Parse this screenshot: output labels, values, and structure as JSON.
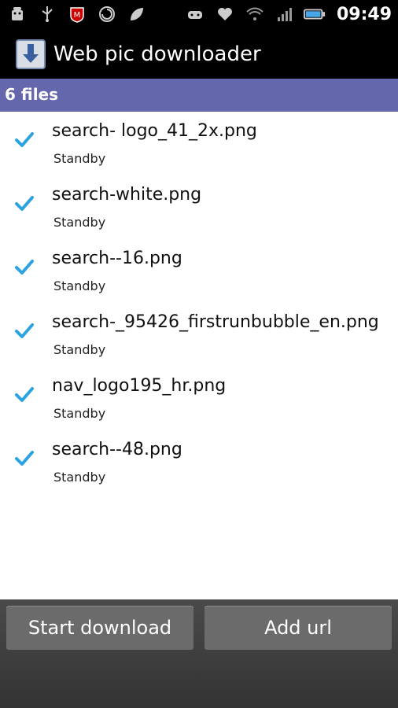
{
  "status_bar": {
    "time": "09:49",
    "left_icons": [
      "android-debug-icon",
      "usb-icon",
      "mcafee-icon",
      "sync-icon",
      "leaf-icon"
    ],
    "right_icons": [
      "gamepad-icon",
      "heart-icon",
      "wifi-icon",
      "signal-icon",
      "battery-icon"
    ]
  },
  "app": {
    "title": "Web pic downloader"
  },
  "list_header": {
    "label": "6 files"
  },
  "files": [
    {
      "name": "search- logo_41_2x.png",
      "status": "Standby"
    },
    {
      "name": "search-white.png",
      "status": "Standby"
    },
    {
      "name": "search--16.png",
      "status": "Standby"
    },
    {
      "name": "search-_95426_firstrunbubble_en.png",
      "status": "Standby"
    },
    {
      "name": "nav_logo195_hr.png",
      "status": "Standby"
    },
    {
      "name": "search--48.png",
      "status": "Standby"
    }
  ],
  "buttons": {
    "start_download": "Start download",
    "add_url": "Add url"
  },
  "colors": {
    "header_bg": "#6567ad",
    "check": "#2aa3e0"
  }
}
